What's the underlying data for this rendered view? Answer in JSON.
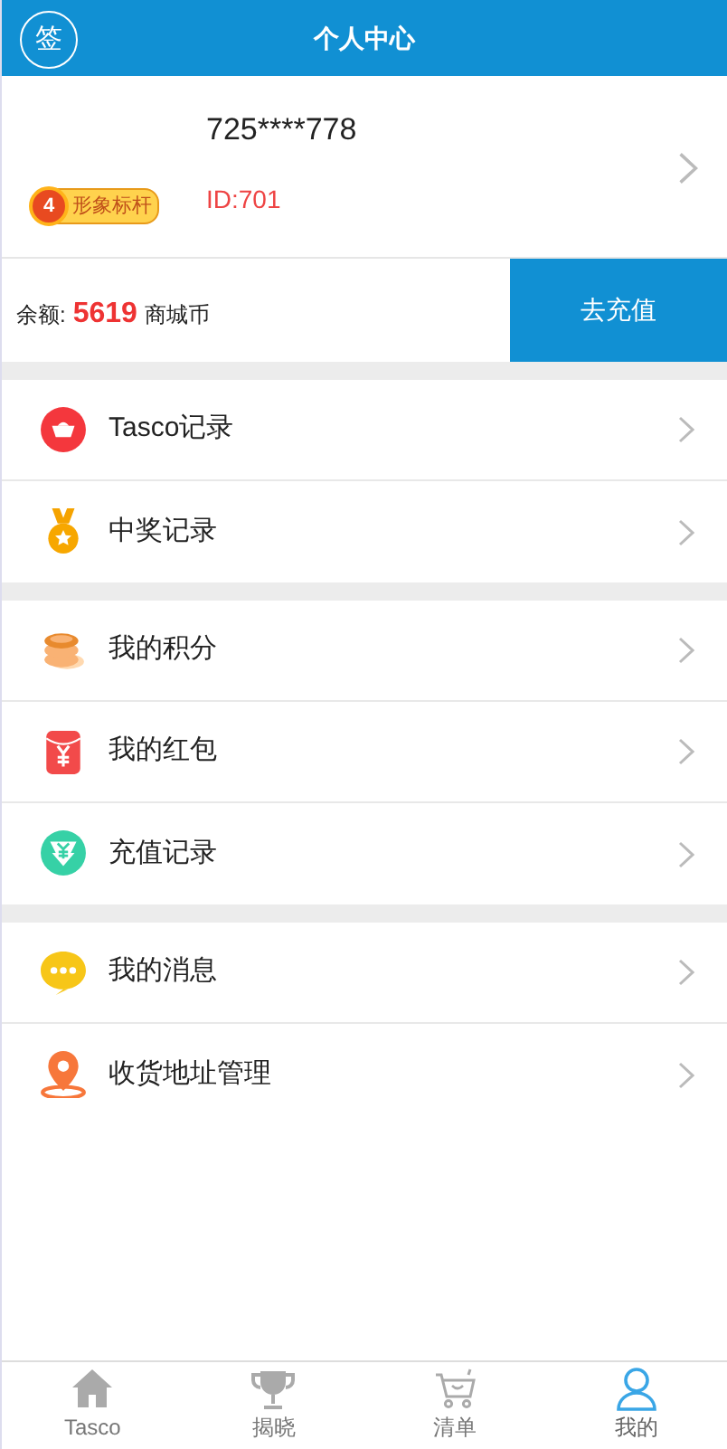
{
  "header": {
    "title": "个人中心",
    "sign_icon_text": "签"
  },
  "profile": {
    "username": "725****778",
    "user_id": "ID:701",
    "badge": {
      "level": "4",
      "label": "形象标杆"
    }
  },
  "balance": {
    "label": "余额:",
    "amount": "5619",
    "unit": "商城币",
    "button": "去充值"
  },
  "menu_groups": [
    {
      "items": [
        {
          "kind": "ingot",
          "label": "Tasco记录"
        },
        {
          "kind": "medal",
          "label": "中奖记录"
        }
      ]
    },
    {
      "items": [
        {
          "kind": "coins",
          "label": "我的积分"
        },
        {
          "kind": "redpacket",
          "label": "我的红包"
        },
        {
          "kind": "recharge",
          "label": "充值记录"
        }
      ]
    },
    {
      "items": [
        {
          "kind": "message",
          "label": "我的消息"
        },
        {
          "kind": "location",
          "label": "收货地址管理"
        }
      ]
    }
  ],
  "tab_bar": [
    {
      "kind": "home",
      "label": "Tasco",
      "selected": false
    },
    {
      "kind": "trophy",
      "label": "揭晓",
      "selected": false
    },
    {
      "kind": "cart",
      "label": "清单",
      "selected": false
    },
    {
      "kind": "person",
      "label": "我的",
      "selected": true
    }
  ]
}
